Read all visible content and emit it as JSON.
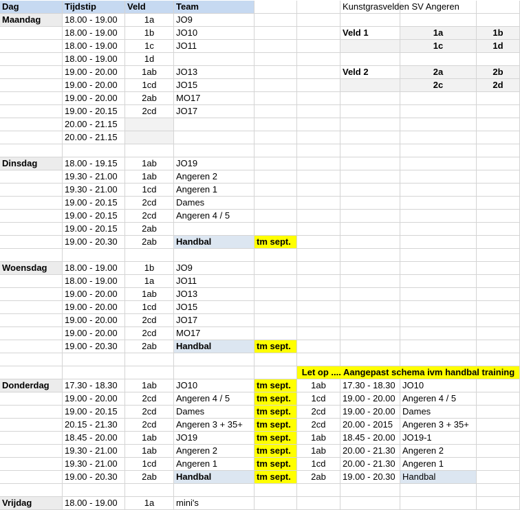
{
  "header": {
    "dag": "Dag",
    "tijdstip": "Tijdstip",
    "veld": "Veld",
    "team": "Team"
  },
  "legend": {
    "title": "Kunstgrasvelden SV Angeren",
    "veld1_label": "Veld 1",
    "veld1_row1": [
      "1a",
      "1b"
    ],
    "veld1_row2": [
      "1c",
      "1d"
    ],
    "veld2_label": "Veld 2",
    "veld2_row1": [
      "2a",
      "2b"
    ],
    "veld2_row2": [
      "2c",
      "2d"
    ]
  },
  "days": {
    "maandag": "Maandag",
    "dinsdag": "Dinsdag",
    "woensdag": "Woensdag",
    "donderdag": "Donderdag",
    "vrijdag": "Vrijdag"
  },
  "maandag_rows": [
    {
      "time": "18.00 - 19.00",
      "veld": "1a",
      "team": "JO9"
    },
    {
      "time": "18.00 - 19.00",
      "veld": "1b",
      "team": "JO10"
    },
    {
      "time": "18.00 - 19.00",
      "veld": "1c",
      "team": "JO11"
    },
    {
      "time": "18.00 - 19.00",
      "veld": "1d",
      "team": ""
    },
    {
      "time": "19.00 - 20.00",
      "veld": "1ab",
      "team": "JO13"
    },
    {
      "time": "19.00 - 20.00",
      "veld": "1cd",
      "team": "JO15"
    },
    {
      "time": "19.00 - 20.00",
      "veld": "2ab",
      "team": "MO17"
    },
    {
      "time": "19.00 - 20.15",
      "veld": "2cd",
      "team": "JO17"
    },
    {
      "time": "20.00 - 21.15",
      "veld": "",
      "team": ""
    },
    {
      "time": "20.00 - 21.15",
      "veld": "",
      "team": ""
    }
  ],
  "dinsdag_rows": [
    {
      "time": "18.00 - 19.15",
      "veld": "1ab",
      "team": "JO19",
      "note": ""
    },
    {
      "time": "19.30 - 21.00",
      "veld": "1ab",
      "team": "Angeren 2",
      "note": ""
    },
    {
      "time": "19.30 - 21.00",
      "veld": "1cd",
      "team": "Angeren 1",
      "note": ""
    },
    {
      "time": "19.00 - 20.15",
      "veld": "2cd",
      "team": "Dames",
      "note": ""
    },
    {
      "time": "19.00 - 20.15",
      "veld": "2cd",
      "team": "Angeren 4 / 5",
      "note": ""
    },
    {
      "time": "19.00 - 20.15",
      "veld": "2ab",
      "team": "",
      "note": ""
    },
    {
      "time": "19.00 - 20.30",
      "veld": "2ab",
      "team": "Handbal",
      "note": "tm sept."
    }
  ],
  "woensdag_rows": [
    {
      "time": "18.00 - 19.00",
      "veld": "1b",
      "team": "JO9",
      "note": ""
    },
    {
      "time": "18.00 - 19.00",
      "veld": "1a",
      "team": "JO11",
      "note": ""
    },
    {
      "time": "19.00 - 20.00",
      "veld": "1ab",
      "team": "JO13",
      "note": ""
    },
    {
      "time": "19.00 - 20.00",
      "veld": "1cd",
      "team": "JO15",
      "note": ""
    },
    {
      "time": "19.00 - 20.00",
      "veld": "2cd",
      "team": "JO17",
      "note": ""
    },
    {
      "time": "19.00 - 20.00",
      "veld": "2cd",
      "team": "MO17",
      "note": ""
    },
    {
      "time": "19.00 - 20.30",
      "veld": "2ab",
      "team": "Handbal",
      "note": "tm sept."
    }
  ],
  "notice": "Let op .... Aangepast schema ivm handbal training",
  "donderdag_rows": [
    {
      "time": "17.30 - 18.30",
      "veld": "1ab",
      "team": "JO10",
      "note": "tm sept.",
      "alt_veld": "1ab",
      "alt_time": "17.30 - 18.30",
      "alt_team": "JO10"
    },
    {
      "time": "19.00 - 20.00",
      "veld": "2cd",
      "team": "Angeren 4 / 5",
      "note": "tm sept.",
      "alt_veld": "1cd",
      "alt_time": "19.00 - 20.00",
      "alt_team": "Angeren 4 / 5"
    },
    {
      "time": "19.00 - 20.15",
      "veld": "2cd",
      "team": "Dames",
      "note": "tm sept.",
      "alt_veld": "2cd",
      "alt_time": "19.00 - 20.00",
      "alt_team": "Dames"
    },
    {
      "time": "20.15 - 21.30",
      "veld": "2cd",
      "team": "Angeren 3 + 35+",
      "note": "tm sept.",
      "alt_veld": "2cd",
      "alt_time": "20.00 - 2015",
      "alt_team": "Angeren 3 + 35+"
    },
    {
      "time": "18.45 - 20.00",
      "veld": "1ab",
      "team": "JO19",
      "note": "tm sept.",
      "alt_veld": "1ab",
      "alt_time": "18.45 - 20.00",
      "alt_team": "JO19-1"
    },
    {
      "time": "19.30 - 21.00",
      "veld": "1ab",
      "team": "Angeren 2",
      "note": "tm sept.",
      "alt_veld": "1ab",
      "alt_time": "20.00 - 21.30",
      "alt_team": "Angeren 2"
    },
    {
      "time": "19.30 - 21.00",
      "veld": "1cd",
      "team": "Angeren 1",
      "note": "tm sept.",
      "alt_veld": "1cd",
      "alt_time": "20.00 - 21.30",
      "alt_team": "Angeren 1"
    },
    {
      "time": "19.00 - 20.30",
      "veld": "2ab",
      "team": "Handbal",
      "note": "tm sept.",
      "alt_veld": "2ab",
      "alt_time": "19.00 - 20.30",
      "alt_team": "Handbal"
    }
  ],
  "vrijdag_rows": [
    {
      "time": "18.00 - 19.00",
      "veld": "1a",
      "team": "mini's"
    }
  ],
  "colors": {
    "header": "#c6d9f1",
    "highlight": "#ffff00",
    "handbal": "#dce6f1",
    "day": "#ececec"
  }
}
